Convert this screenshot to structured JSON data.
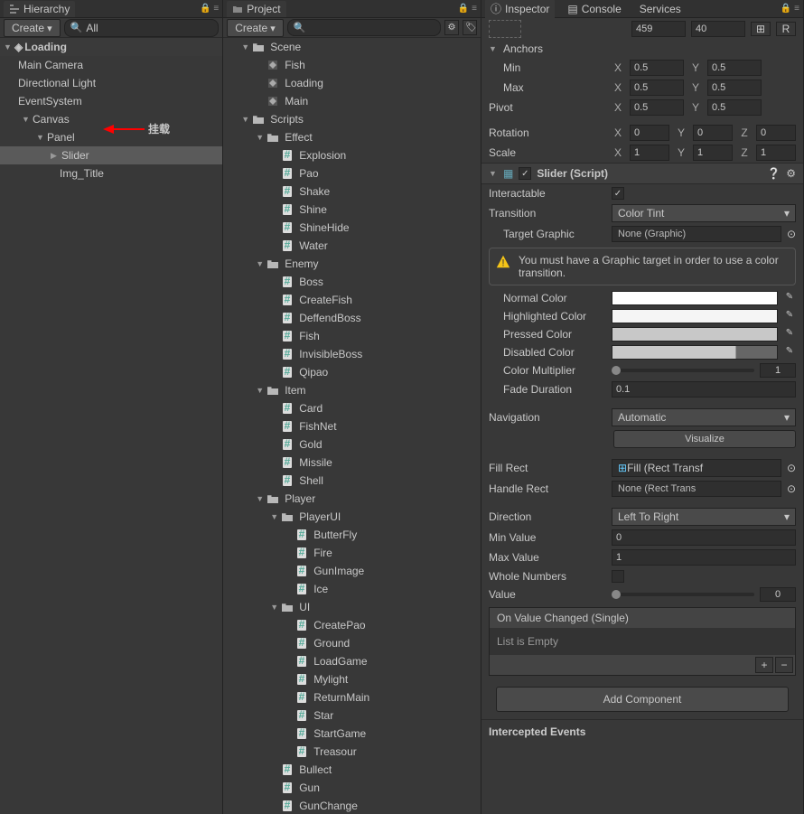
{
  "hierarchy": {
    "tab": "Hierarchy",
    "create": "Create",
    "search": "All",
    "scene": "Loading",
    "items": [
      "Main Camera",
      "Directional Light",
      "EventSystem",
      "Canvas",
      "Panel",
      "Slider",
      "Img_Title"
    ],
    "annotation": "挂载"
  },
  "project": {
    "tab": "Project",
    "create": "Create",
    "tree": {
      "scene": "Scene",
      "scene_items": [
        "Fish",
        "Loading",
        "Main"
      ],
      "scripts": "Scripts",
      "effect": "Effect",
      "effect_items": [
        "Explosion",
        "Pao",
        "Shake",
        "Shine",
        "ShineHide",
        "Water"
      ],
      "enemy": "Enemy",
      "enemy_items": [
        "Boss",
        "CreateFish",
        "DeffendBoss",
        "Fish",
        "InvisibleBoss",
        "Qipao"
      ],
      "item": "Item",
      "item_items": [
        "Card",
        "FishNet",
        "Gold",
        "Missile",
        "Shell"
      ],
      "player": "Player",
      "playerui": "PlayerUI",
      "playerui_items": [
        "ButterFly",
        "Fire",
        "GunImage",
        "Ice"
      ],
      "ui": "UI",
      "ui_items": [
        "CreatePao",
        "Ground",
        "LoadGame",
        "Mylight",
        "ReturnMain",
        "Star",
        "StartGame",
        "Treasour"
      ],
      "bullet": "Bullect",
      "gun": "Gun",
      "gunchange": "GunChange"
    }
  },
  "inspector": {
    "tabs": [
      "Inspector",
      "Console",
      "Services"
    ],
    "header_vals": [
      "459",
      "40"
    ],
    "anchors": "Anchors",
    "min": "Min",
    "max": "Max",
    "pivot": "Pivot",
    "rotation": "Rotation",
    "scale": "Scale",
    "x": "X",
    "y": "Y",
    "z": "Z",
    "anchor_min": [
      "0.5",
      "0.5"
    ],
    "anchor_max": [
      "0.5",
      "0.5"
    ],
    "pivot_v": [
      "0.5",
      "0.5"
    ],
    "rot_v": [
      "0",
      "0",
      "0"
    ],
    "scale_v": [
      "1",
      "1",
      "1"
    ],
    "component": "Slider (Script)",
    "interactable": "Interactable",
    "transition": "Transition",
    "transition_v": "Color Tint",
    "target_graphic": "Target Graphic",
    "target_graphic_v": "None (Graphic)",
    "warning": "You must have a Graphic target in order to use a color transition.",
    "normal_color": "Normal Color",
    "highlighted_color": "Highlighted Color",
    "pressed_color": "Pressed Color",
    "disabled_color": "Disabled Color",
    "color_mult": "Color Multiplier",
    "color_mult_v": "1",
    "fade_duration": "Fade Duration",
    "fade_duration_v": "0.1",
    "navigation": "Navigation",
    "navigation_v": "Automatic",
    "visualize": "Visualize",
    "fill_rect": "Fill Rect",
    "fill_rect_v": "Fill (Rect Transf",
    "handle_rect": "Handle Rect",
    "handle_rect_v": "None (Rect Trans",
    "direction": "Direction",
    "direction_v": "Left To Right",
    "min_value": "Min Value",
    "min_value_v": "0",
    "max_value": "Max Value",
    "max_value_v": "1",
    "whole_numbers": "Whole Numbers",
    "value": "Value",
    "value_v": "0",
    "events_header": "On Value Changed (Single)",
    "events_body": "List is Empty",
    "add_component": "Add Component",
    "refresh": "R",
    "intercepted": "Intercepted Events"
  }
}
